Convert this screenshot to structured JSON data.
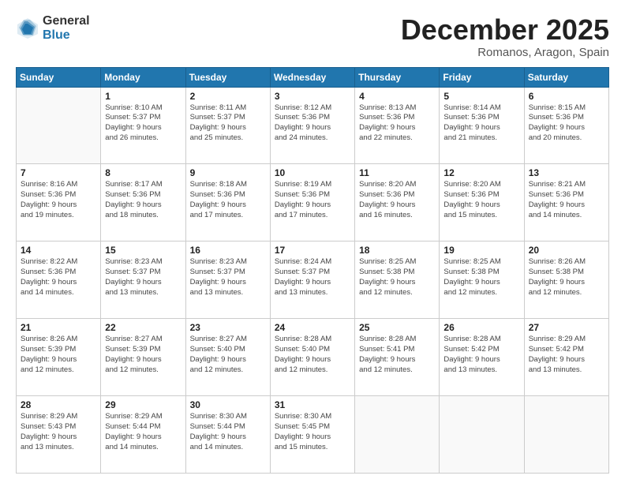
{
  "logo": {
    "general": "General",
    "blue": "Blue"
  },
  "header": {
    "month": "December 2025",
    "location": "Romanos, Aragon, Spain"
  },
  "weekdays": [
    "Sunday",
    "Monday",
    "Tuesday",
    "Wednesday",
    "Thursday",
    "Friday",
    "Saturday"
  ],
  "weeks": [
    [
      {
        "day": "",
        "info": ""
      },
      {
        "day": "1",
        "info": "Sunrise: 8:10 AM\nSunset: 5:37 PM\nDaylight: 9 hours\nand 26 minutes."
      },
      {
        "day": "2",
        "info": "Sunrise: 8:11 AM\nSunset: 5:37 PM\nDaylight: 9 hours\nand 25 minutes."
      },
      {
        "day": "3",
        "info": "Sunrise: 8:12 AM\nSunset: 5:36 PM\nDaylight: 9 hours\nand 24 minutes."
      },
      {
        "day": "4",
        "info": "Sunrise: 8:13 AM\nSunset: 5:36 PM\nDaylight: 9 hours\nand 22 minutes."
      },
      {
        "day": "5",
        "info": "Sunrise: 8:14 AM\nSunset: 5:36 PM\nDaylight: 9 hours\nand 21 minutes."
      },
      {
        "day": "6",
        "info": "Sunrise: 8:15 AM\nSunset: 5:36 PM\nDaylight: 9 hours\nand 20 minutes."
      }
    ],
    [
      {
        "day": "7",
        "info": "Sunrise: 8:16 AM\nSunset: 5:36 PM\nDaylight: 9 hours\nand 19 minutes."
      },
      {
        "day": "8",
        "info": "Sunrise: 8:17 AM\nSunset: 5:36 PM\nDaylight: 9 hours\nand 18 minutes."
      },
      {
        "day": "9",
        "info": "Sunrise: 8:18 AM\nSunset: 5:36 PM\nDaylight: 9 hours\nand 17 minutes."
      },
      {
        "day": "10",
        "info": "Sunrise: 8:19 AM\nSunset: 5:36 PM\nDaylight: 9 hours\nand 17 minutes."
      },
      {
        "day": "11",
        "info": "Sunrise: 8:20 AM\nSunset: 5:36 PM\nDaylight: 9 hours\nand 16 minutes."
      },
      {
        "day": "12",
        "info": "Sunrise: 8:20 AM\nSunset: 5:36 PM\nDaylight: 9 hours\nand 15 minutes."
      },
      {
        "day": "13",
        "info": "Sunrise: 8:21 AM\nSunset: 5:36 PM\nDaylight: 9 hours\nand 14 minutes."
      }
    ],
    [
      {
        "day": "14",
        "info": "Sunrise: 8:22 AM\nSunset: 5:36 PM\nDaylight: 9 hours\nand 14 minutes."
      },
      {
        "day": "15",
        "info": "Sunrise: 8:23 AM\nSunset: 5:37 PM\nDaylight: 9 hours\nand 13 minutes."
      },
      {
        "day": "16",
        "info": "Sunrise: 8:23 AM\nSunset: 5:37 PM\nDaylight: 9 hours\nand 13 minutes."
      },
      {
        "day": "17",
        "info": "Sunrise: 8:24 AM\nSunset: 5:37 PM\nDaylight: 9 hours\nand 13 minutes."
      },
      {
        "day": "18",
        "info": "Sunrise: 8:25 AM\nSunset: 5:38 PM\nDaylight: 9 hours\nand 12 minutes."
      },
      {
        "day": "19",
        "info": "Sunrise: 8:25 AM\nSunset: 5:38 PM\nDaylight: 9 hours\nand 12 minutes."
      },
      {
        "day": "20",
        "info": "Sunrise: 8:26 AM\nSunset: 5:38 PM\nDaylight: 9 hours\nand 12 minutes."
      }
    ],
    [
      {
        "day": "21",
        "info": "Sunrise: 8:26 AM\nSunset: 5:39 PM\nDaylight: 9 hours\nand 12 minutes."
      },
      {
        "day": "22",
        "info": "Sunrise: 8:27 AM\nSunset: 5:39 PM\nDaylight: 9 hours\nand 12 minutes."
      },
      {
        "day": "23",
        "info": "Sunrise: 8:27 AM\nSunset: 5:40 PM\nDaylight: 9 hours\nand 12 minutes."
      },
      {
        "day": "24",
        "info": "Sunrise: 8:28 AM\nSunset: 5:40 PM\nDaylight: 9 hours\nand 12 minutes."
      },
      {
        "day": "25",
        "info": "Sunrise: 8:28 AM\nSunset: 5:41 PM\nDaylight: 9 hours\nand 12 minutes."
      },
      {
        "day": "26",
        "info": "Sunrise: 8:28 AM\nSunset: 5:42 PM\nDaylight: 9 hours\nand 13 minutes."
      },
      {
        "day": "27",
        "info": "Sunrise: 8:29 AM\nSunset: 5:42 PM\nDaylight: 9 hours\nand 13 minutes."
      }
    ],
    [
      {
        "day": "28",
        "info": "Sunrise: 8:29 AM\nSunset: 5:43 PM\nDaylight: 9 hours\nand 13 minutes."
      },
      {
        "day": "29",
        "info": "Sunrise: 8:29 AM\nSunset: 5:44 PM\nDaylight: 9 hours\nand 14 minutes."
      },
      {
        "day": "30",
        "info": "Sunrise: 8:30 AM\nSunset: 5:44 PM\nDaylight: 9 hours\nand 14 minutes."
      },
      {
        "day": "31",
        "info": "Sunrise: 8:30 AM\nSunset: 5:45 PM\nDaylight: 9 hours\nand 15 minutes."
      },
      {
        "day": "",
        "info": ""
      },
      {
        "day": "",
        "info": ""
      },
      {
        "day": "",
        "info": ""
      }
    ]
  ]
}
